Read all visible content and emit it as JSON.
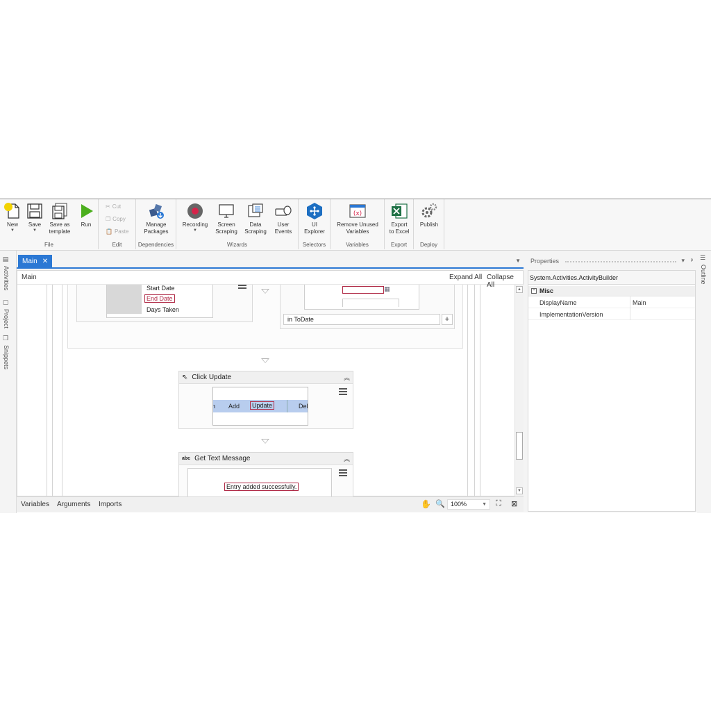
{
  "ribbon": {
    "groups": [
      {
        "label": "File"
      },
      {
        "label": "Edit"
      },
      {
        "label": "Dependencies"
      },
      {
        "label": "Wizards"
      },
      {
        "label": "Selectors"
      },
      {
        "label": "Variables"
      },
      {
        "label": "Export"
      },
      {
        "label": "Deploy"
      }
    ],
    "buttons": {
      "new": "New",
      "save": "Save",
      "save_as_template": "Save as\ntemplate",
      "run": "Run",
      "cut": "Cut",
      "copy": "Copy",
      "paste": "Paste",
      "manage_packages": "Manage\nPackages",
      "recording": "Recording",
      "screen_scraping": "Screen\nScraping",
      "data_scraping": "Data\nScraping",
      "user_events": "User\nEvents",
      "ui_explorer": "UI\nExplorer",
      "remove_unused_variables": "Remove Unused\nVariables",
      "export_to_excel": "Export\nto Excel",
      "publish": "Publish"
    }
  },
  "left_rail": {
    "activities": "Activities",
    "project": "Project",
    "snippets": "Snippets"
  },
  "right_rail": {
    "outline": "Outline"
  },
  "tabs": {
    "main": "Main"
  },
  "designer": {
    "breadcrumb": "Main",
    "expand_all": "Expand All",
    "collapse_all": "Collapse All",
    "top_list": [
      "Start Date",
      "End Date",
      "Days Taken"
    ],
    "todate_field": "in  ToDate",
    "click_update": {
      "title": "Click Update",
      "buttons": [
        "Add",
        "Update",
        "Del"
      ]
    },
    "get_text": {
      "title": "Get Text Message",
      "message": "Entry added successfully."
    }
  },
  "bottom_bar": {
    "variables": "Variables",
    "arguments": "Arguments",
    "imports": "Imports",
    "zoom": "100%"
  },
  "properties": {
    "title": "Properties",
    "type": "System.Activities.ActivityBuilder",
    "category": "Misc",
    "rows": [
      {
        "name": "DisplayName",
        "value": "Main"
      },
      {
        "name": "ImplementationVersion",
        "value": ""
      }
    ]
  },
  "colors": {
    "accent": "#2b78d4",
    "selector_highlight": "#b02a46",
    "run_green": "#4caf1e",
    "record_red": "#d6244a"
  }
}
